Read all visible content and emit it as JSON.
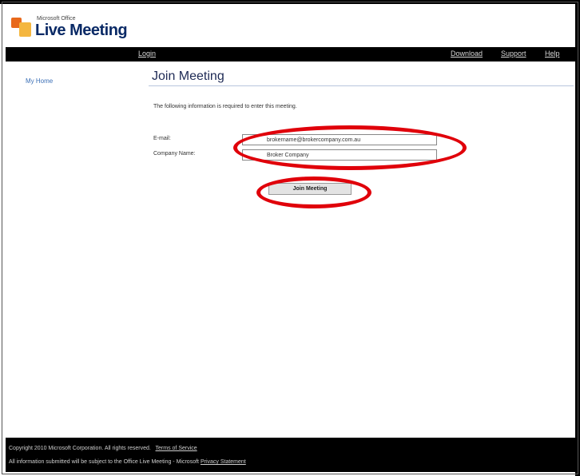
{
  "branding": {
    "small_text": "Microsoft Office",
    "big_text": "Live Meeting"
  },
  "nav": {
    "login": "Login",
    "download": "Download",
    "support": "Support",
    "help": "Help"
  },
  "sidebar": {
    "link": "My Home"
  },
  "main": {
    "title": "Join Meeting",
    "intro": "The following information is required to enter this meeting.",
    "email_label": "E-mail:",
    "email_value": "brokername@brokercompany.com.au",
    "company_label": "Company Name:",
    "company_value": "Broker Company",
    "join_button": "Join Meeting"
  },
  "footer": {
    "copyright": "Copyright 2010 Microsoft Corporation. All rights reserved.",
    "terms_link": "Terms of Service",
    "notice": "All information submitted will be subject to the Office Live Meeting - Microsoft",
    "privacy_link": "Privacy Statement"
  },
  "colors": {
    "annotation": "#e0000a",
    "navbar": "#000000",
    "title": "#1e2a55"
  }
}
